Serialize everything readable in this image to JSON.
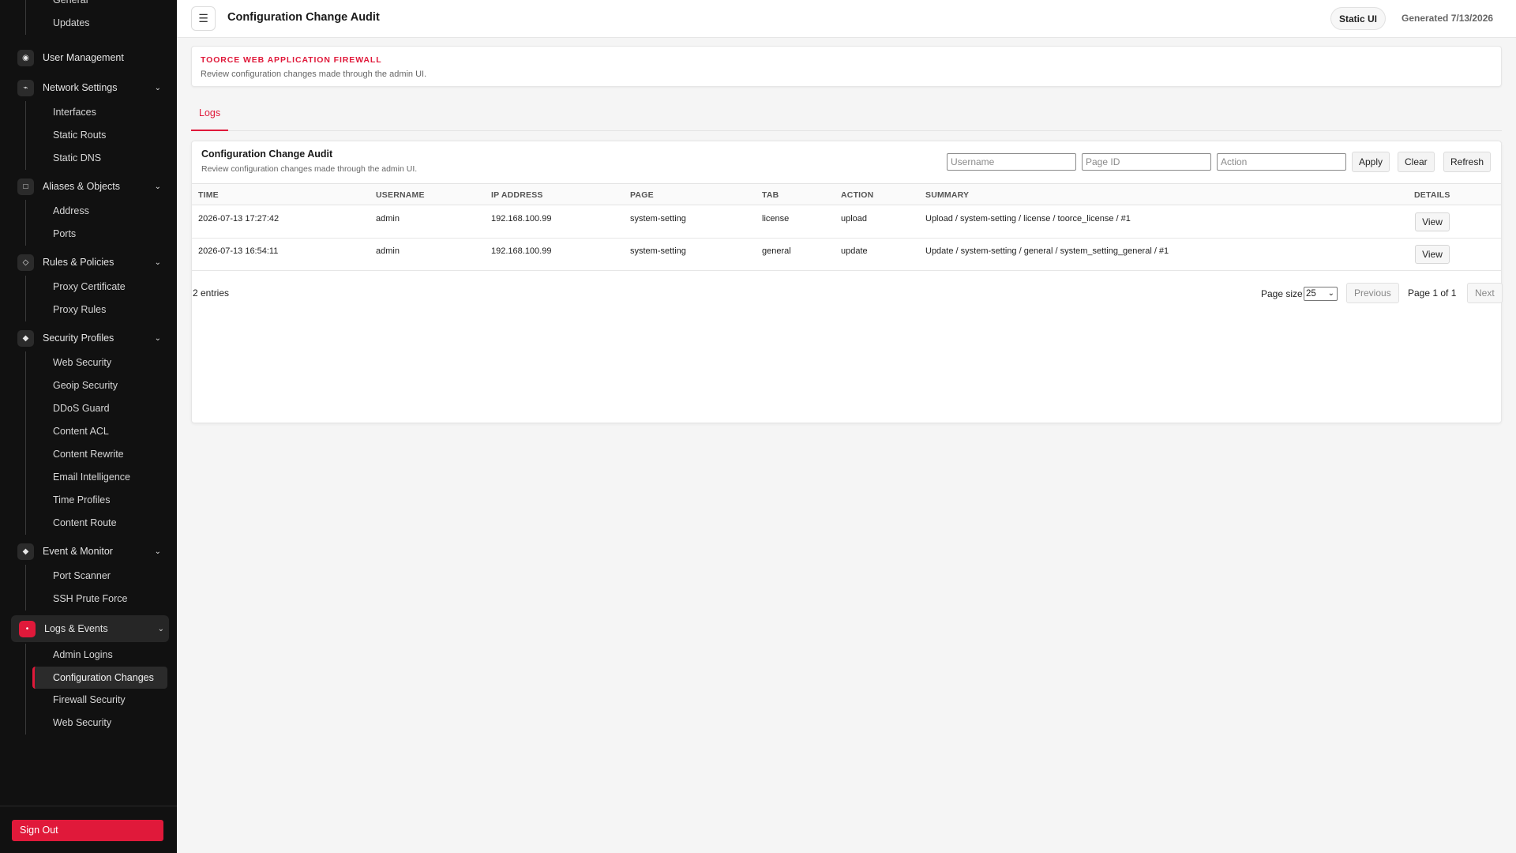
{
  "sidebar": {
    "top_items": [
      "General",
      "Updates"
    ],
    "groups": [
      {
        "label": "User Management",
        "icon": "user-icon",
        "glyph": "◉",
        "children": []
      },
      {
        "label": "Network Settings",
        "icon": "network-icon",
        "glyph": "⌁",
        "children": [
          "Interfaces",
          "Static Routs",
          "Static DNS"
        ]
      },
      {
        "label": "Aliases & Objects",
        "icon": "objects-icon",
        "glyph": "□",
        "children": [
          "Address",
          "Ports"
        ]
      },
      {
        "label": "Rules & Policies",
        "icon": "rules-icon",
        "glyph": "◇",
        "children": [
          "Proxy Certificate",
          "Proxy Rules"
        ]
      },
      {
        "label": "Security Profiles",
        "icon": "shield-icon",
        "glyph": "◆",
        "children": [
          "Web Security",
          "Geoip Security",
          "DDoS Guard",
          "Content ACL",
          "Content Rewrite",
          "Email Intelligence",
          "Time Profiles",
          "Content Route"
        ]
      },
      {
        "label": "Event & Monitor",
        "icon": "monitor-icon",
        "glyph": "◆",
        "children": [
          "Port Scanner",
          "SSH Prute Force"
        ]
      },
      {
        "label": "Logs & Events",
        "icon": "logs-icon",
        "glyph": "•",
        "children": [
          "Admin Logins",
          "Configuration Changes",
          "Firewall Security",
          "Web Security"
        ]
      }
    ],
    "sign_out": "Sign Out"
  },
  "topbar": {
    "menu_glyph": "☰",
    "title": "Configuration Change Audit",
    "static_badge": "Static UI",
    "generated": "Generated 7/13/2026"
  },
  "banner": {
    "brand": "TOORCE WEB APPLICATION FIREWALL",
    "description": "Review configuration changes made through the admin UI."
  },
  "tabs": [
    "Logs"
  ],
  "card": {
    "title": "Configuration Change Audit",
    "description": "Review configuration changes made through the admin UI.",
    "filters": {
      "username_placeholder": "Username",
      "page_id_placeholder": "Page ID",
      "action_placeholder": "Action"
    },
    "buttons": {
      "apply": "Apply",
      "clear": "Clear",
      "refresh": "Refresh"
    },
    "columns": [
      "TIME",
      "USERNAME",
      "IP ADDRESS",
      "PAGE",
      "TAB",
      "ACTION",
      "SUMMARY",
      "DETAILS"
    ],
    "rows": [
      {
        "time": "2026-07-13 17:27:42",
        "username": "admin",
        "ip": "192.168.100.99",
        "page": "system-setting",
        "tab": "license",
        "action": "upload",
        "summary": "Upload / system-setting / license / toorce_license / #1",
        "details": "View"
      },
      {
        "time": "2026-07-13 16:54:11",
        "username": "admin",
        "ip": "192.168.100.99",
        "page": "system-setting",
        "tab": "general",
        "action": "update",
        "summary": "Update / system-setting / general / system_setting_general / #1",
        "details": "View"
      }
    ],
    "entries": "2 entries",
    "pager": {
      "page_size_label": "Page size",
      "page_size": "25",
      "previous": "Previous",
      "page_info": "Page 1 of 1",
      "next": "Next"
    }
  },
  "colors": {
    "accent": "#e0193a",
    "sidebar_bg": "#111111"
  }
}
